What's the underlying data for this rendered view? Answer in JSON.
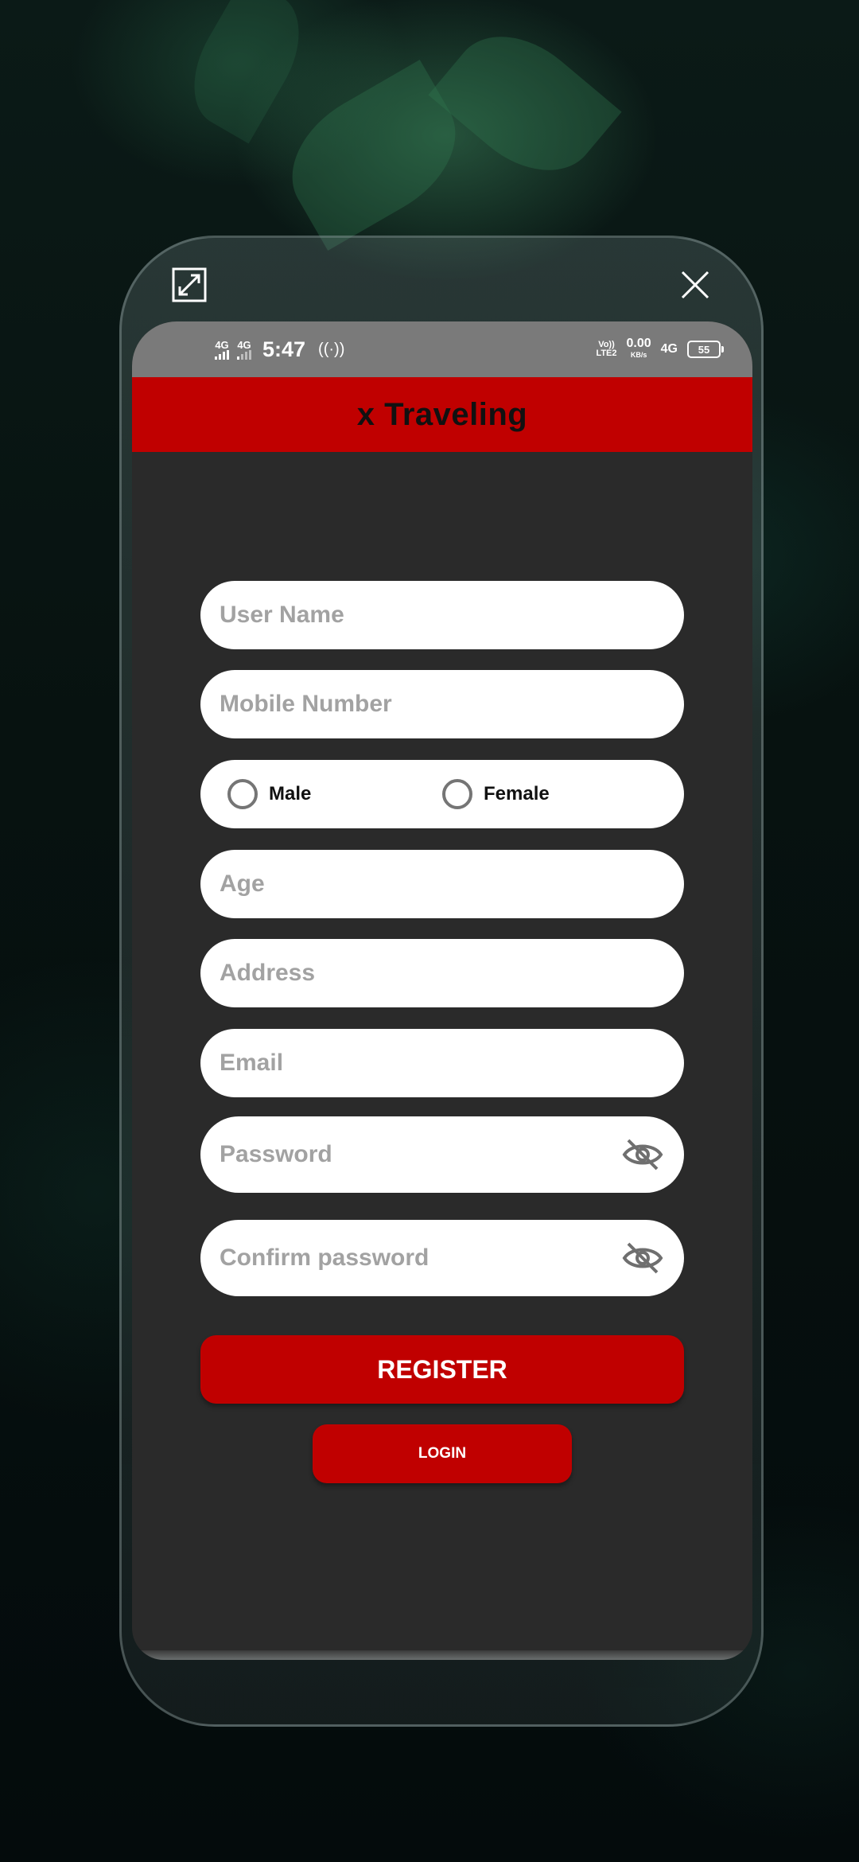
{
  "app": {
    "title": "x Traveling"
  },
  "statusbar": {
    "net1": "4G",
    "net2": "4G",
    "time": "5:47",
    "volte_top": "Vo))",
    "volte_bottom": "LTE2",
    "speed_value": "0.00",
    "speed_unit": "KB/s",
    "net3": "4G",
    "battery": "55"
  },
  "frame": {
    "expand_icon": "expand-icon",
    "close_icon": "close-icon"
  },
  "form": {
    "username_placeholder": "User Name",
    "mobile_placeholder": "Mobile Number",
    "gender": {
      "male": "Male",
      "female": "Female",
      "selected": ""
    },
    "age_placeholder": "Age",
    "address_placeholder": "Address",
    "email_placeholder": "Email",
    "password_placeholder": "Password",
    "confirm_password_placeholder": "Confirm password",
    "register_label": "REGISTER",
    "login_label": "LOGIN"
  },
  "colors": {
    "accent": "#c00000",
    "screen_bg": "#2a2a2a",
    "statusbar_bg": "#7a7a7a",
    "field_bg": "#ffffff",
    "placeholder": "#a2a2a2"
  }
}
